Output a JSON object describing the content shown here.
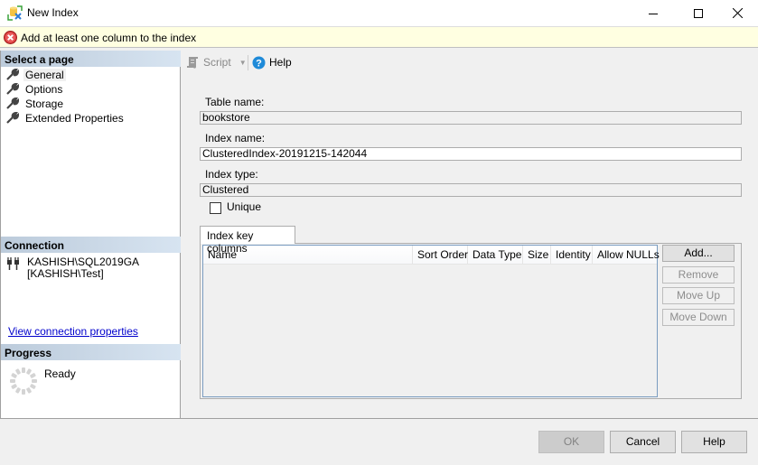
{
  "window": {
    "title": "New Index",
    "controls": {
      "minimize": "minimize",
      "maximize": "maximize",
      "close": "close"
    }
  },
  "banner": {
    "icon": "error-icon",
    "message": "Add at least one column to the index"
  },
  "sidebar": {
    "select_page_header": "Select a page",
    "pages": [
      {
        "label": "General",
        "icon": "wrench-icon",
        "selected": true
      },
      {
        "label": "Options",
        "icon": "wrench-icon",
        "selected": false
      },
      {
        "label": "Storage",
        "icon": "wrench-icon",
        "selected": false
      },
      {
        "label": "Extended Properties",
        "icon": "wrench-icon",
        "selected": false
      }
    ],
    "connection_header": "Connection",
    "connection": {
      "server": "KASHISH\\SQL2019GA",
      "user": "[KASHISH\\Test]"
    },
    "view_connection_link": "View connection properties",
    "progress_header": "Progress",
    "progress_status": "Ready"
  },
  "toolbar": {
    "script_label": "Script",
    "help_label": "Help"
  },
  "form": {
    "table_name_label": "Table name:",
    "table_name_value": "bookstore",
    "index_name_label": "Index name:",
    "index_name_value": "ClusteredIndex-20191215-142044",
    "index_type_label": "Index type:",
    "index_type_value": "Clustered",
    "unique_label": "Unique",
    "unique_checked": false
  },
  "key_columns": {
    "tab_label": "Index key columns",
    "columns": [
      "Name",
      "Sort Order",
      "Data Type",
      "Size",
      "Identity",
      "Allow NULLs"
    ],
    "rows": [],
    "buttons": {
      "add": "Add...",
      "remove": "Remove",
      "move_up": "Move Up",
      "move_down": "Move Down"
    }
  },
  "footer": {
    "ok": "OK",
    "cancel": "Cancel",
    "help": "Help"
  }
}
